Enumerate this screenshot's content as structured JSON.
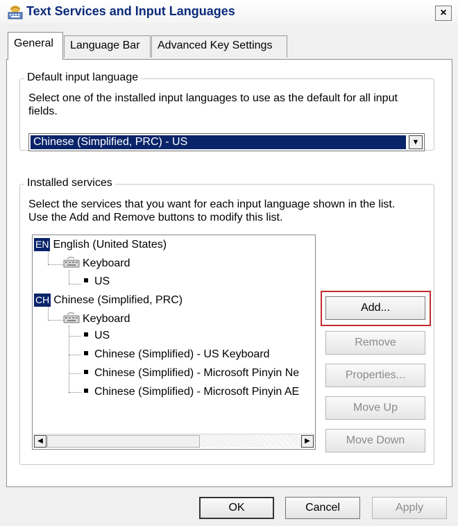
{
  "window": {
    "title": "Text Services and Input Languages",
    "close_glyph": "×"
  },
  "tabs": [
    {
      "label": "General",
      "active": true
    },
    {
      "label": "Language Bar",
      "active": false
    },
    {
      "label": "Advanced Key Settings",
      "active": false
    }
  ],
  "default_language": {
    "group_label": "Default input language",
    "description_line1": "Select one of the installed input languages to use as the default for all input",
    "description_line2": "fields.",
    "selected": "Chinese (Simplified, PRC) - US"
  },
  "installed_services": {
    "group_label": "Installed services",
    "description_line1": "Select the services that you want for each input language shown in the list.",
    "description_line2": "Use the Add and Remove buttons to modify this list.",
    "tree": [
      {
        "badge": "EN",
        "label": "English (United States)",
        "children": [
          {
            "label": "Keyboard",
            "icon": "keyboard-icon",
            "children": [
              "US"
            ]
          }
        ]
      },
      {
        "badge": "CH",
        "label": "Chinese (Simplified, PRC)",
        "children": [
          {
            "label": "Keyboard",
            "icon": "keyboard-icon",
            "children": [
              "US",
              "Chinese (Simplified) - US Keyboard",
              "Chinese (Simplified) - Microsoft Pinyin Ne",
              "Chinese (Simplified) - Microsoft Pinyin AE"
            ]
          }
        ]
      }
    ],
    "buttons": {
      "add": "Add...",
      "remove": "Remove",
      "properties": "Properties...",
      "move_up": "Move Up",
      "move_down": "Move Down"
    }
  },
  "footer": {
    "ok": "OK",
    "cancel": "Cancel",
    "apply": "Apply"
  },
  "colors": {
    "selection": "#0a246a",
    "title_text": "#0b2a7a",
    "highlight_box": "#c42b2b"
  }
}
